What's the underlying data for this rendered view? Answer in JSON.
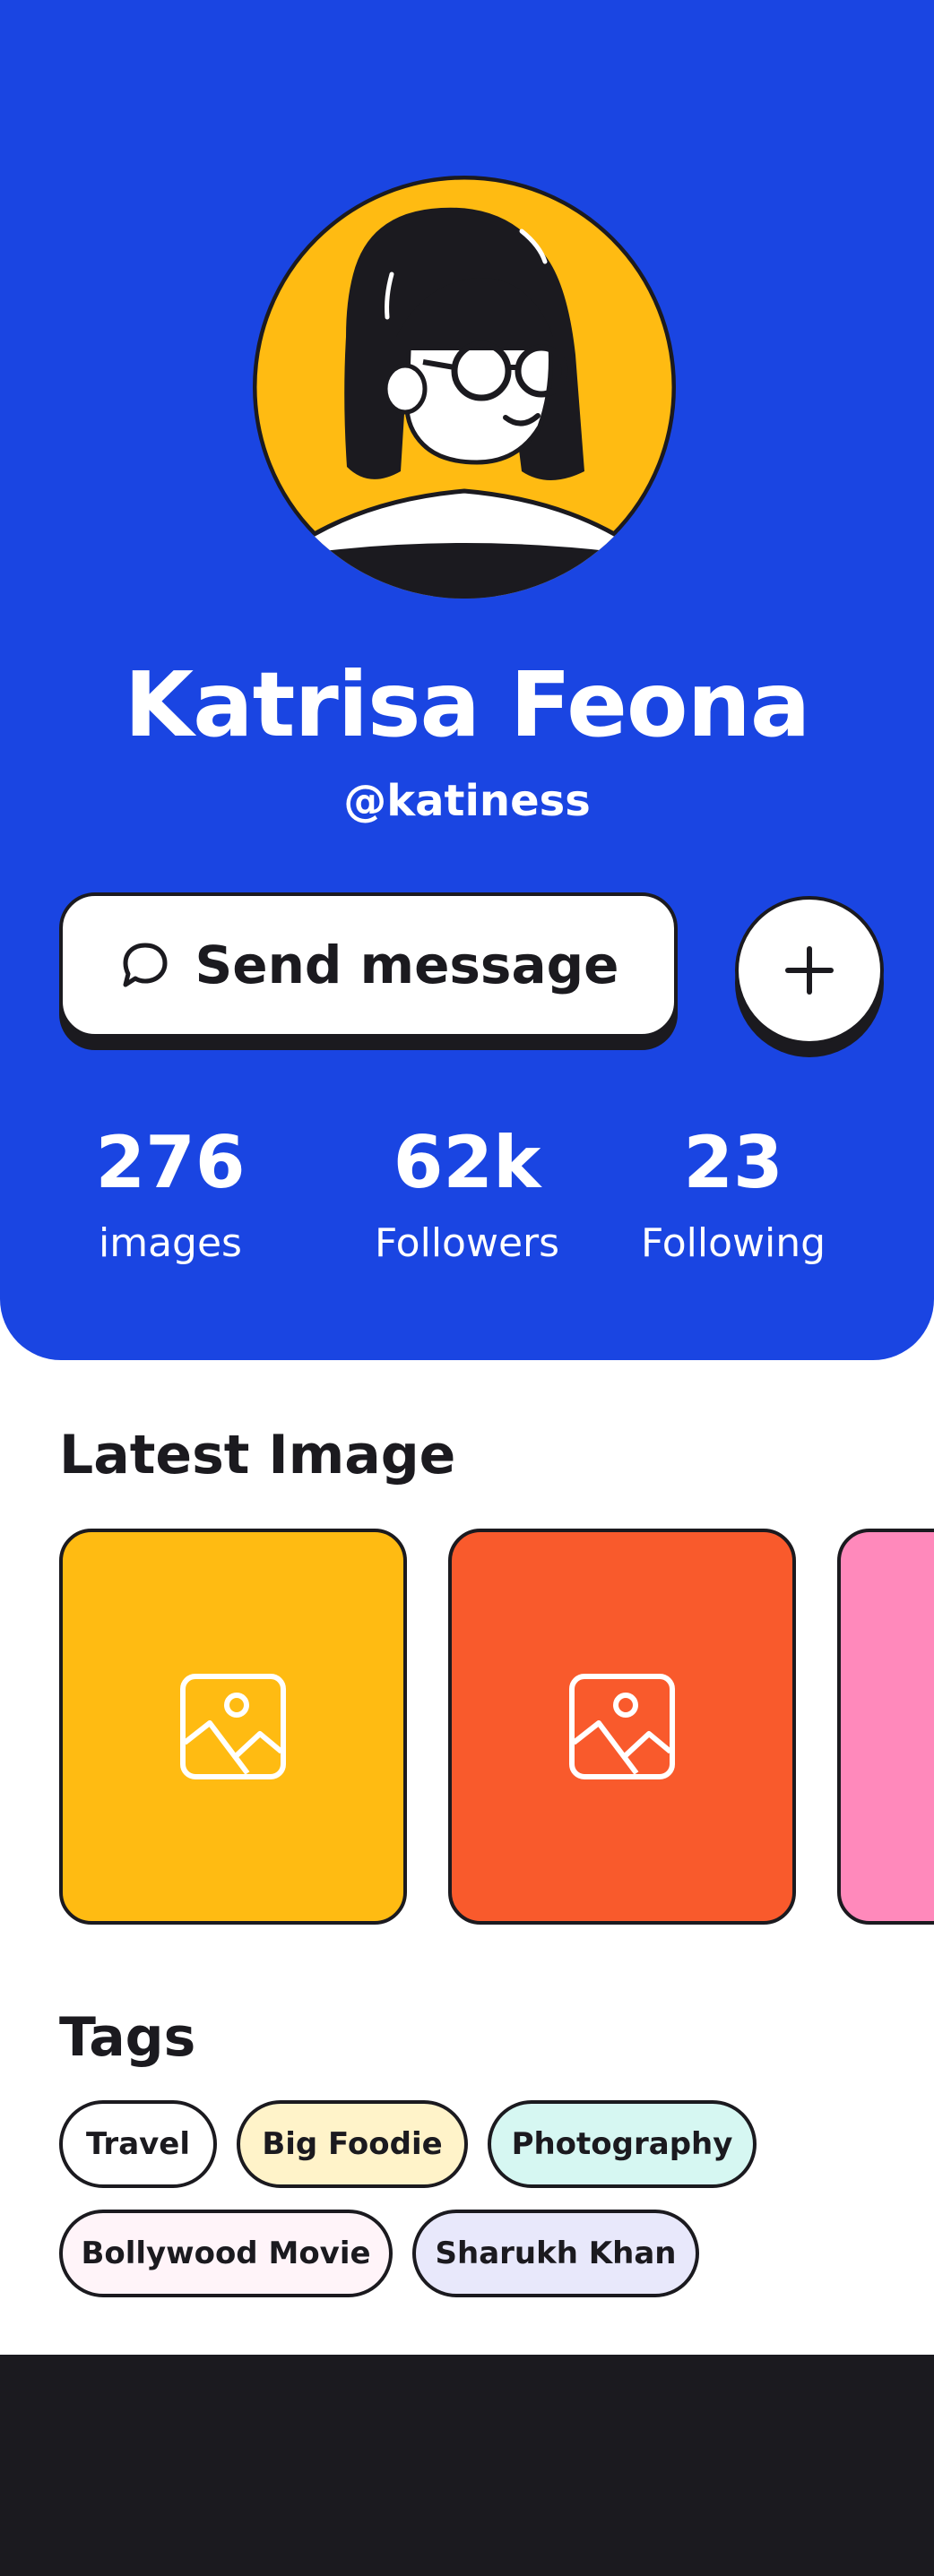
{
  "profile": {
    "name": "Katrisa Feona",
    "handle": "@katiness",
    "avatar_icon": "avatar-illustration"
  },
  "actions": {
    "send_message_label": "Send message",
    "send_message_icon": "chat-bubble-icon",
    "add_icon": "plus-icon"
  },
  "stats": [
    {
      "value": "276",
      "label": "images"
    },
    {
      "value": "62k",
      "label": "Followers"
    },
    {
      "value": "23",
      "label": "Following"
    }
  ],
  "latest": {
    "title": "Latest Image",
    "cards": [
      {
        "color": "#ffbb12",
        "icon": "image-icon"
      },
      {
        "color": "#f95a2c",
        "icon": "image-icon"
      },
      {
        "color": "#ff89bb",
        "icon": "image-icon"
      }
    ]
  },
  "tags": {
    "title": "Tags",
    "items": [
      {
        "label": "Travel",
        "color": "#ffffff"
      },
      {
        "label": "Big Foodie",
        "color": "#fff3c9"
      },
      {
        "label": "Photography",
        "color": "#d6f7f2"
      },
      {
        "label": "Bollywood Movie",
        "color": "#fff4f9"
      },
      {
        "label": "Sharukh Khan",
        "color": "#e8e8fb"
      }
    ]
  },
  "colors": {
    "brand_blue": "#1a45e2",
    "ink": "#1b1a1f",
    "avatar_yellow": "#ffbb12"
  }
}
